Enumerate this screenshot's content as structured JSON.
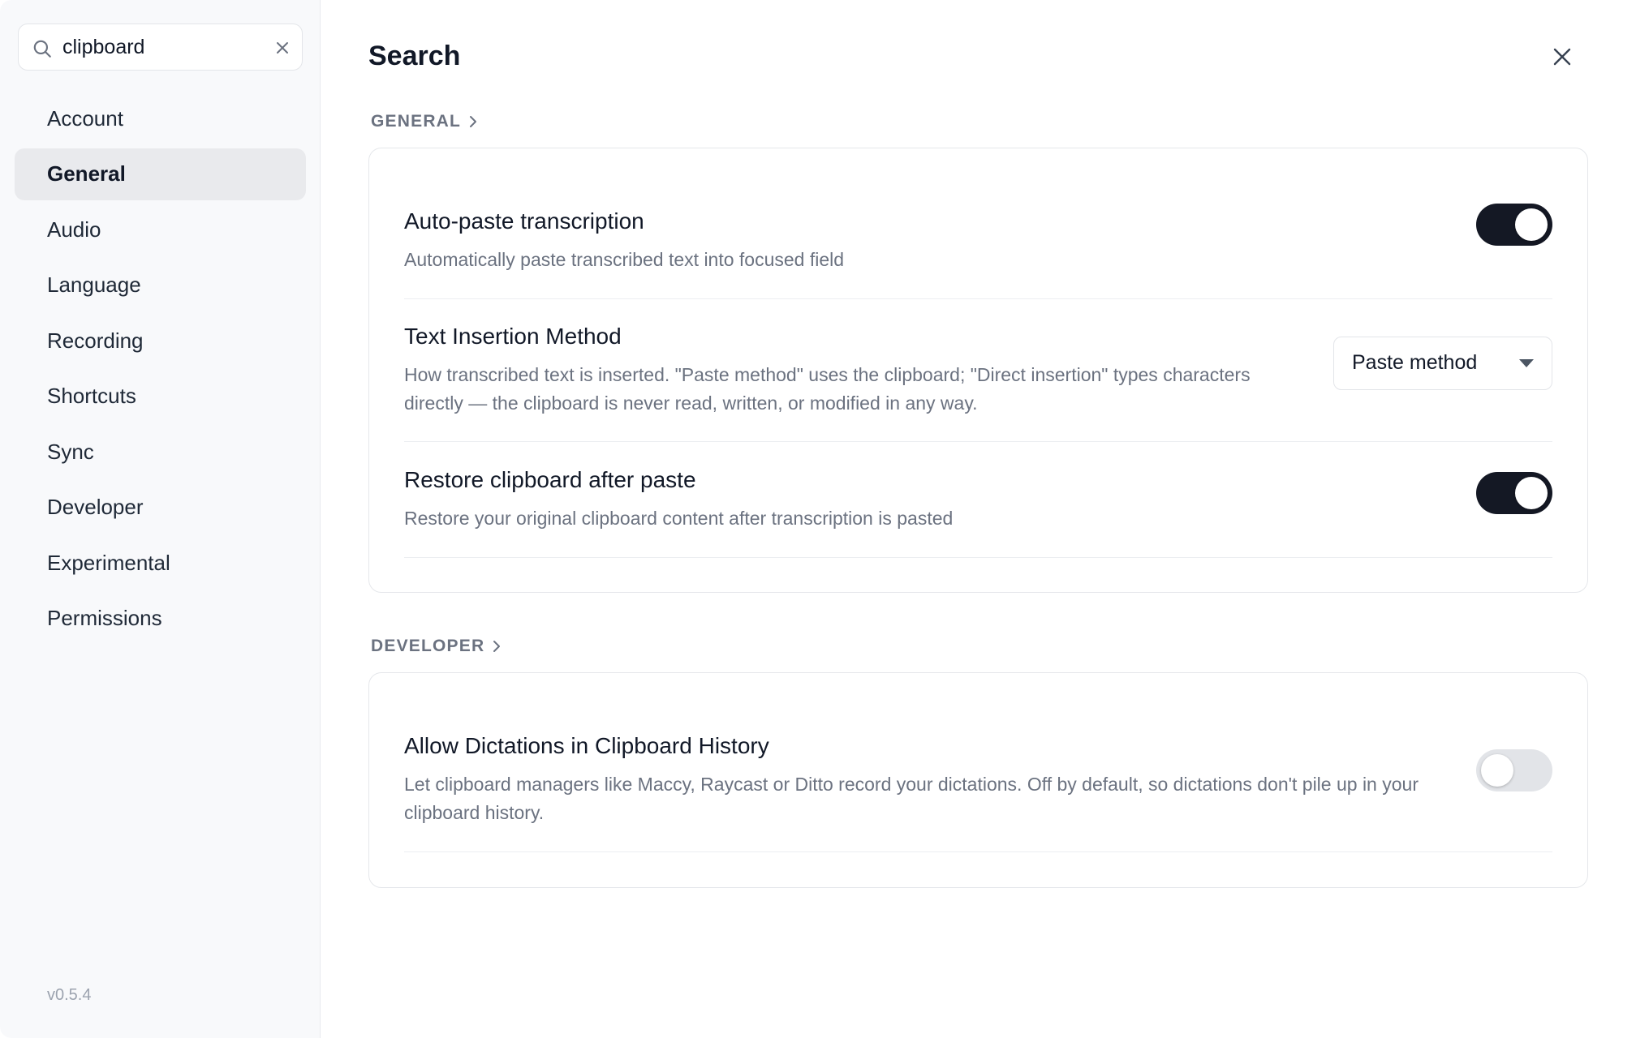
{
  "sidebar": {
    "search": {
      "value": "clipboard",
      "placeholder": "Search"
    },
    "items": [
      {
        "label": "Account"
      },
      {
        "label": "General",
        "active": true
      },
      {
        "label": "Audio"
      },
      {
        "label": "Language"
      },
      {
        "label": "Recording"
      },
      {
        "label": "Shortcuts"
      },
      {
        "label": "Sync"
      },
      {
        "label": "Developer"
      },
      {
        "label": "Experimental"
      },
      {
        "label": "Permissions"
      }
    ],
    "version": "v0.5.4"
  },
  "main": {
    "title": "Search",
    "sections": [
      {
        "label": "GENERAL",
        "rows": [
          {
            "title": "Auto-paste transcription",
            "description": "Automatically paste transcribed text into focused field",
            "control": "toggle",
            "enabled": true
          },
          {
            "title": "Text Insertion Method",
            "description": "How transcribed text is inserted. \"Paste method\" uses the clipboard; \"Direct insertion\" types characters directly — the clipboard is never read, written, or modified in any way.",
            "control": "select",
            "selected": "Paste method"
          },
          {
            "title": "Restore clipboard after paste",
            "description": "Restore your original clipboard content after transcription is pasted",
            "control": "toggle",
            "enabled": true
          }
        ]
      },
      {
        "label": "DEVELOPER",
        "rows": [
          {
            "title": "Allow Dictations in Clipboard History",
            "description": "Let clipboard managers like Maccy, Raycast or Ditto record your dictations. Off by default, so dictations don't pile up in your clipboard history.",
            "control": "toggle",
            "enabled": false
          }
        ]
      }
    ]
  },
  "colors": {
    "toggle_on": "#141824",
    "toggle_off": "#e2e4e8",
    "active_nav": "#e9eaed",
    "muted_text": "#6b7280"
  }
}
